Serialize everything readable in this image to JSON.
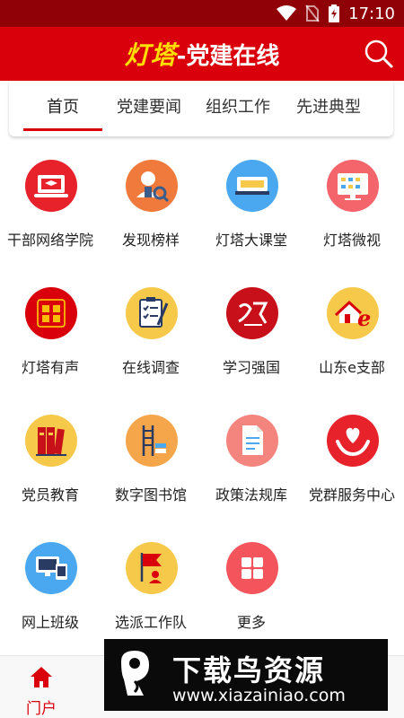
{
  "status_bar": {
    "time": "17:10"
  },
  "header": {
    "title_brand": "灯塔",
    "title_rest": "-党建在线"
  },
  "tabs": [
    {
      "label": "首页",
      "active": true
    },
    {
      "label": "党建要闻",
      "active": false
    },
    {
      "label": "组织工作",
      "active": false
    },
    {
      "label": "先进典型",
      "active": false
    }
  ],
  "grid": [
    {
      "label": "干部网络学院",
      "icon": "laptop-book-icon",
      "color": "#e8222a"
    },
    {
      "label": "发现榜样",
      "icon": "person-search-icon",
      "color": "#f07a3c"
    },
    {
      "label": "灯塔大课堂",
      "icon": "classroom-board-icon",
      "color": "#4aa8f0"
    },
    {
      "label": "灯塔微视",
      "icon": "monitor-icon",
      "color": "#f4646b"
    },
    {
      "label": "灯塔有声",
      "icon": "audio-badge-icon",
      "color": "#d9000b"
    },
    {
      "label": "在线调查",
      "icon": "survey-clipboard-icon",
      "color": "#f6c94a"
    },
    {
      "label": "学习强国",
      "icon": "xuexi-logo-icon",
      "color": "#c8101a"
    },
    {
      "label": "山东e支部",
      "icon": "house-e-icon",
      "color": "#f6c94a"
    },
    {
      "label": "党员教育",
      "icon": "books-icon",
      "color": "#f6c94a"
    },
    {
      "label": "数字图书馆",
      "icon": "library-ladder-icon",
      "color": "#f5a54a"
    },
    {
      "label": "政策法规库",
      "icon": "document-icon",
      "color": "#f4857e"
    },
    {
      "label": "党群服务中心",
      "icon": "heart-hands-icon",
      "color": "#e8222a"
    },
    {
      "label": "网上班级",
      "icon": "online-class-icon",
      "color": "#4aa8f0"
    },
    {
      "label": "选派工作队",
      "icon": "flag-team-icon",
      "color": "#f6c94a"
    },
    {
      "label": "更多",
      "icon": "more-grid-icon",
      "color": "#f4555c"
    }
  ],
  "bottom_nav": {
    "home_label": "门户"
  },
  "watermark": {
    "main": "下载鸟资源",
    "sub": "www.xiazainiao.com"
  }
}
